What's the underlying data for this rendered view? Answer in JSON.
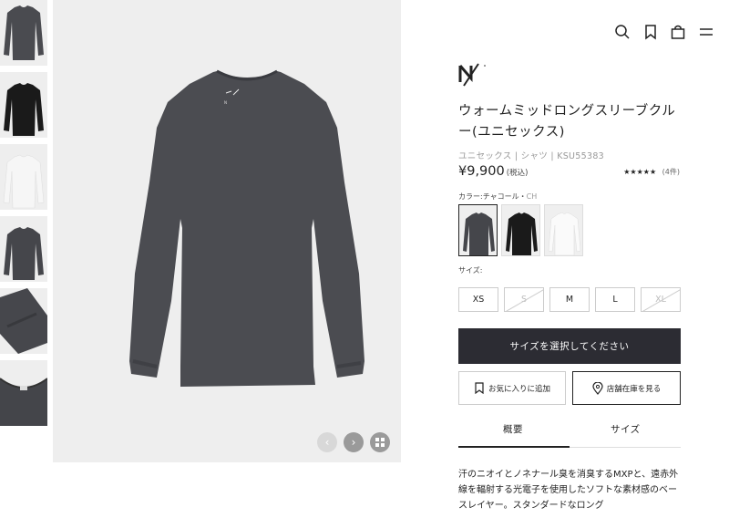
{
  "product": {
    "title": "ウォームミッドロングスリーブクルー(ユニセックス)",
    "meta": "ユニセックス | シャツ | KSU55383",
    "price": "¥9,900",
    "tax": "(税込)",
    "rating_stars": "★★★★★",
    "rating_count": "(4件)",
    "color_label": "カラー:チャコール・",
    "color_value": "CH",
    "size_label": "サイズ:",
    "sizes": [
      {
        "label": "XS",
        "available": true
      },
      {
        "label": "S",
        "available": false
      },
      {
        "label": "M",
        "available": true
      },
      {
        "label": "L",
        "available": true
      },
      {
        "label": "XL",
        "available": false
      }
    ],
    "cta_label": "サイズを選択してください",
    "favorite_label": "お気に入りに追加",
    "store_label": "店舗在庫を見る",
    "tabs": [
      "概要",
      "サイズ"
    ],
    "description": "汗のニオイとノネナール臭を消臭するMXPと、遠赤外線を輻射する光電子を使用したソフトな素材感のベースレイヤー。スタンダードなロング"
  },
  "colors": {
    "charcoal": "#3c3d42",
    "black": "#1a1a1a",
    "white": "#f3f3f3",
    "cta_bg": "#2c2c33"
  },
  "icons": {
    "header": [
      "search-icon",
      "bookmark-icon",
      "bag-icon",
      "menu-icon"
    ],
    "image_controls": [
      "chevron-left-icon",
      "chevron-right-icon",
      "grid-icon"
    ]
  }
}
